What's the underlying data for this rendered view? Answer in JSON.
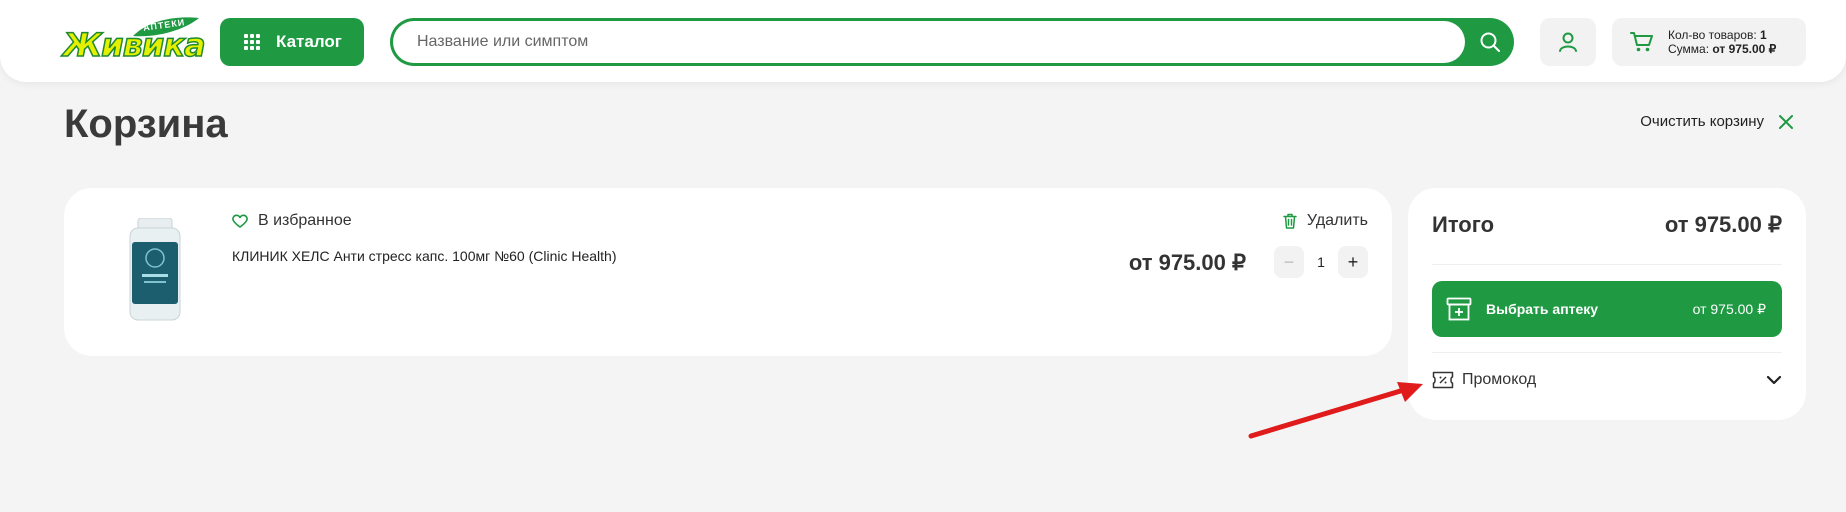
{
  "header": {
    "logo": {
      "top_text": "АПТЕКИ",
      "main_text": "Живика"
    },
    "catalog_label": "Каталог",
    "search": {
      "placeholder": "Название или симптом",
      "value": ""
    },
    "cart": {
      "count_label": "Кол-во товаров:",
      "count": "1",
      "sum_label": "Сумма:",
      "sum": "от 975.00 ₽"
    }
  },
  "page": {
    "title": "Корзина",
    "clear_label": "Очистить корзину"
  },
  "cart_items": [
    {
      "favorite_label": "В избранное",
      "name": "КЛИНИК ХЕЛС Анти стресс капс. 100мг №60 (Clinic Health)",
      "delete_label": "Удалить",
      "price": "от 975.00 ₽",
      "quantity": "1",
      "minus": "−",
      "plus": "+"
    }
  ],
  "summary": {
    "total_label": "Итого",
    "total_value": "от 975.00 ₽",
    "choose_pharmacy_label": "Выбрать аптеку",
    "choose_pharmacy_amount": "от 975.00 ₽",
    "promo_label": "Промокод"
  },
  "colors": {
    "brand_green": "#1f9a43",
    "logo_yellow": "#e4f000",
    "annotation_arrow": "#e01b1b"
  },
  "icons": [
    "grid-icon",
    "search-icon",
    "user-icon",
    "cart-icon",
    "close-icon",
    "heart-icon",
    "trash-icon",
    "pharmacy-box-icon",
    "promo-ticket-icon",
    "chevron-down-icon"
  ]
}
